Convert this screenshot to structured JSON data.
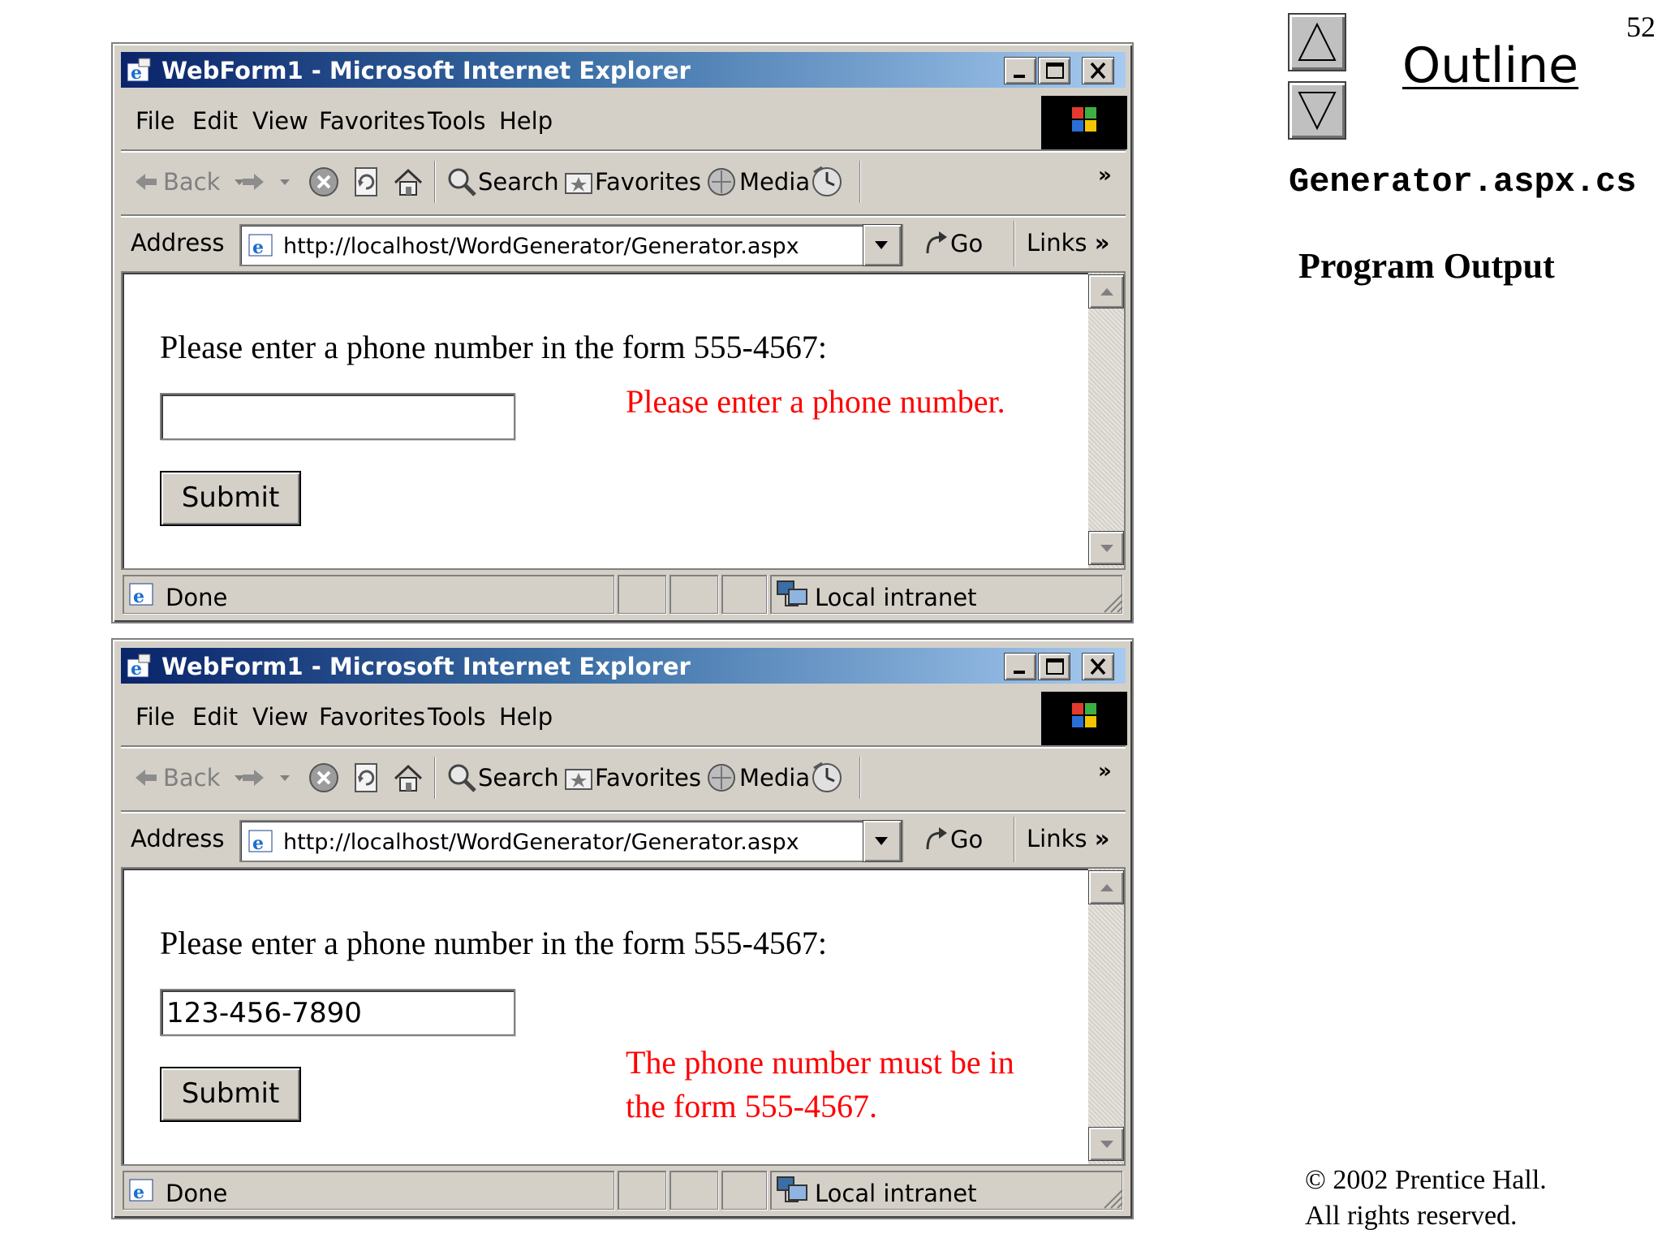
{
  "slide": {
    "page_number": "52",
    "outline_label": "Outline",
    "file_name": "Generator.aspx.cs",
    "subtitle": "Program Output",
    "copyright_line1": "© 2002 Prentice Hall.",
    "copyright_line2": "All rights reserved."
  },
  "windows": [
    {
      "title": "WebForm1 - Microsoft Internet Explorer",
      "menu": [
        "File",
        "Edit",
        "View",
        "Favorites",
        "Tools",
        "Help"
      ],
      "toolbar": {
        "back": "Back",
        "search": "Search",
        "favorites": "Favorites",
        "media": "Media"
      },
      "address": {
        "label": "Address",
        "url": "http://localhost/WordGenerator/Generator.aspx",
        "go": "Go",
        "links": "Links"
      },
      "page": {
        "prompt": "Please enter a phone number in the form 555-4567:",
        "input_value": "",
        "submit_label": "Submit",
        "error_line1": "Please enter a phone number.",
        "error_line2": ""
      },
      "status": {
        "text": "Done",
        "zone": "Local intranet"
      }
    },
    {
      "title": "WebForm1 - Microsoft Internet Explorer",
      "menu": [
        "File",
        "Edit",
        "View",
        "Favorites",
        "Tools",
        "Help"
      ],
      "toolbar": {
        "back": "Back",
        "search": "Search",
        "favorites": "Favorites",
        "media": "Media"
      },
      "address": {
        "label": "Address",
        "url": "http://localhost/WordGenerator/Generator.aspx",
        "go": "Go",
        "links": "Links"
      },
      "page": {
        "prompt": "Please enter a phone number in the form 555-4567:",
        "input_value": "123-456-7890",
        "submit_label": "Submit",
        "error_line1": "The phone number must be in",
        "error_line2": "the form 555-4567."
      },
      "status": {
        "text": "Done",
        "zone": "Local intranet"
      }
    }
  ],
  "icons": {
    "nav_up": "triangle-up-icon",
    "nav_down": "triangle-down-icon",
    "ie_logo": "ie-logo-icon",
    "windows_logo": "windows-flag-icon"
  }
}
